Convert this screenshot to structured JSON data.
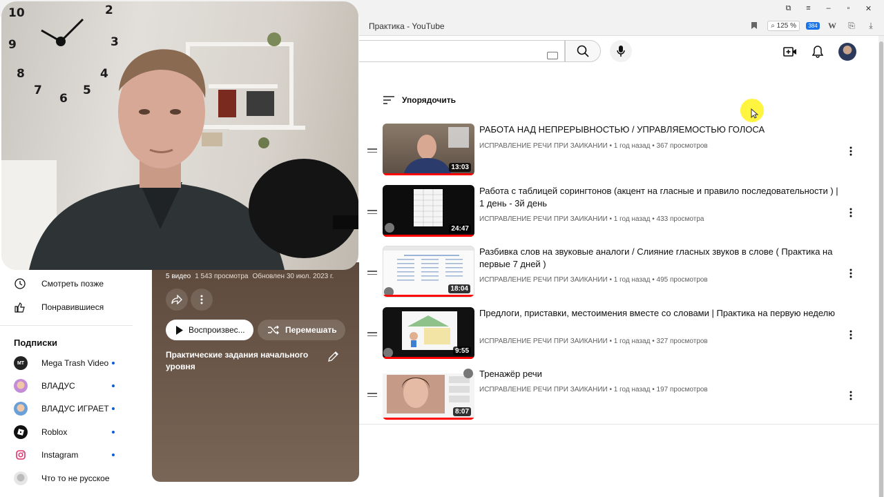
{
  "browser": {
    "tab_title": "Практика - YouTube",
    "zoom": "125 %",
    "badge_count": "384"
  },
  "sidebar": {
    "items": [
      {
        "label": "Смотреть позже",
        "icon": "clock-icon"
      },
      {
        "label": "Понравившиеся",
        "icon": "thumbs-up-icon"
      }
    ],
    "subscriptions_heading": "Подписки",
    "subscriptions": [
      {
        "name": "Mega Trash Video",
        "avatar_text": "MT",
        "color": "#222222"
      },
      {
        "name": "ВЛАДУС",
        "avatar_text": "",
        "color": "#c48bd6"
      },
      {
        "name": "ВЛАДУС ИГРАЕТ",
        "avatar_text": "",
        "color": "#6aa0d8"
      },
      {
        "name": "Roblox",
        "avatar_text": "",
        "color": "#111111"
      },
      {
        "name": "Instagram",
        "avatar_text": "",
        "color": "#e1306c"
      },
      {
        "name": "Что то не русское",
        "avatar_text": "",
        "color": "#dddddd"
      }
    ]
  },
  "playlist": {
    "video_count": "5 видео",
    "views": "1 543 просмотра",
    "updated": "Обновлен 30 июл. 2023 г.",
    "play_label": "Воспроизвес...",
    "shuffle_label": "Перемешать",
    "description": "Практические задания начального уровня"
  },
  "main": {
    "sort_label": "Упорядочить",
    "videos": [
      {
        "title": "РАБОТА НАД НЕПРЕРЫВНОСТЬЮ / УПРАВЛЯЕМОСТЬЮ ГОЛОСА",
        "channel": "ИСПРАВЛЕНИЕ РЕЧИ ПРИ ЗАИКАНИИ",
        "age": "1 год назад",
        "views": "367 просмотров",
        "duration": "13:03"
      },
      {
        "title": "Работа с таблицей сорингтонов (акцент на гласные и правило последовательности ) | 1 день - 3й день",
        "channel": "ИСПРАВЛЕНИЕ РЕЧИ ПРИ ЗАИКАНИИ",
        "age": "1 год назад",
        "views": "433 просмотра",
        "duration": "24:47"
      },
      {
        "title": "Разбивка слов на звуковые аналоги / Слияние гласных звуков в слове ( Практика на первые 7 дней )",
        "channel": "ИСПРАВЛЕНИЕ РЕЧИ ПРИ ЗАИКАНИИ",
        "age": "1 год назад",
        "views": "495 просмотров",
        "duration": "18:04"
      },
      {
        "title": "Предлоги, приставки, местоимения вместе со словами | Практика на первую неделю",
        "channel": "ИСПРАВЛЕНИЕ РЕЧИ ПРИ ЗАИКАНИИ",
        "age": "1 год назад",
        "views": "327 просмотров",
        "duration": "9:55"
      },
      {
        "title": "Тренажёр речи",
        "channel": "ИСПРАВЛЕНИЕ РЕЧИ ПРИ ЗАИКАНИИ",
        "age": "1 год назад",
        "views": "197 просмотров",
        "duration": "8:07"
      }
    ]
  },
  "webcam": {
    "clock_numbers": [
      "10",
      "2",
      "9",
      "3",
      "8",
      "4",
      "7",
      "6",
      "5"
    ]
  }
}
